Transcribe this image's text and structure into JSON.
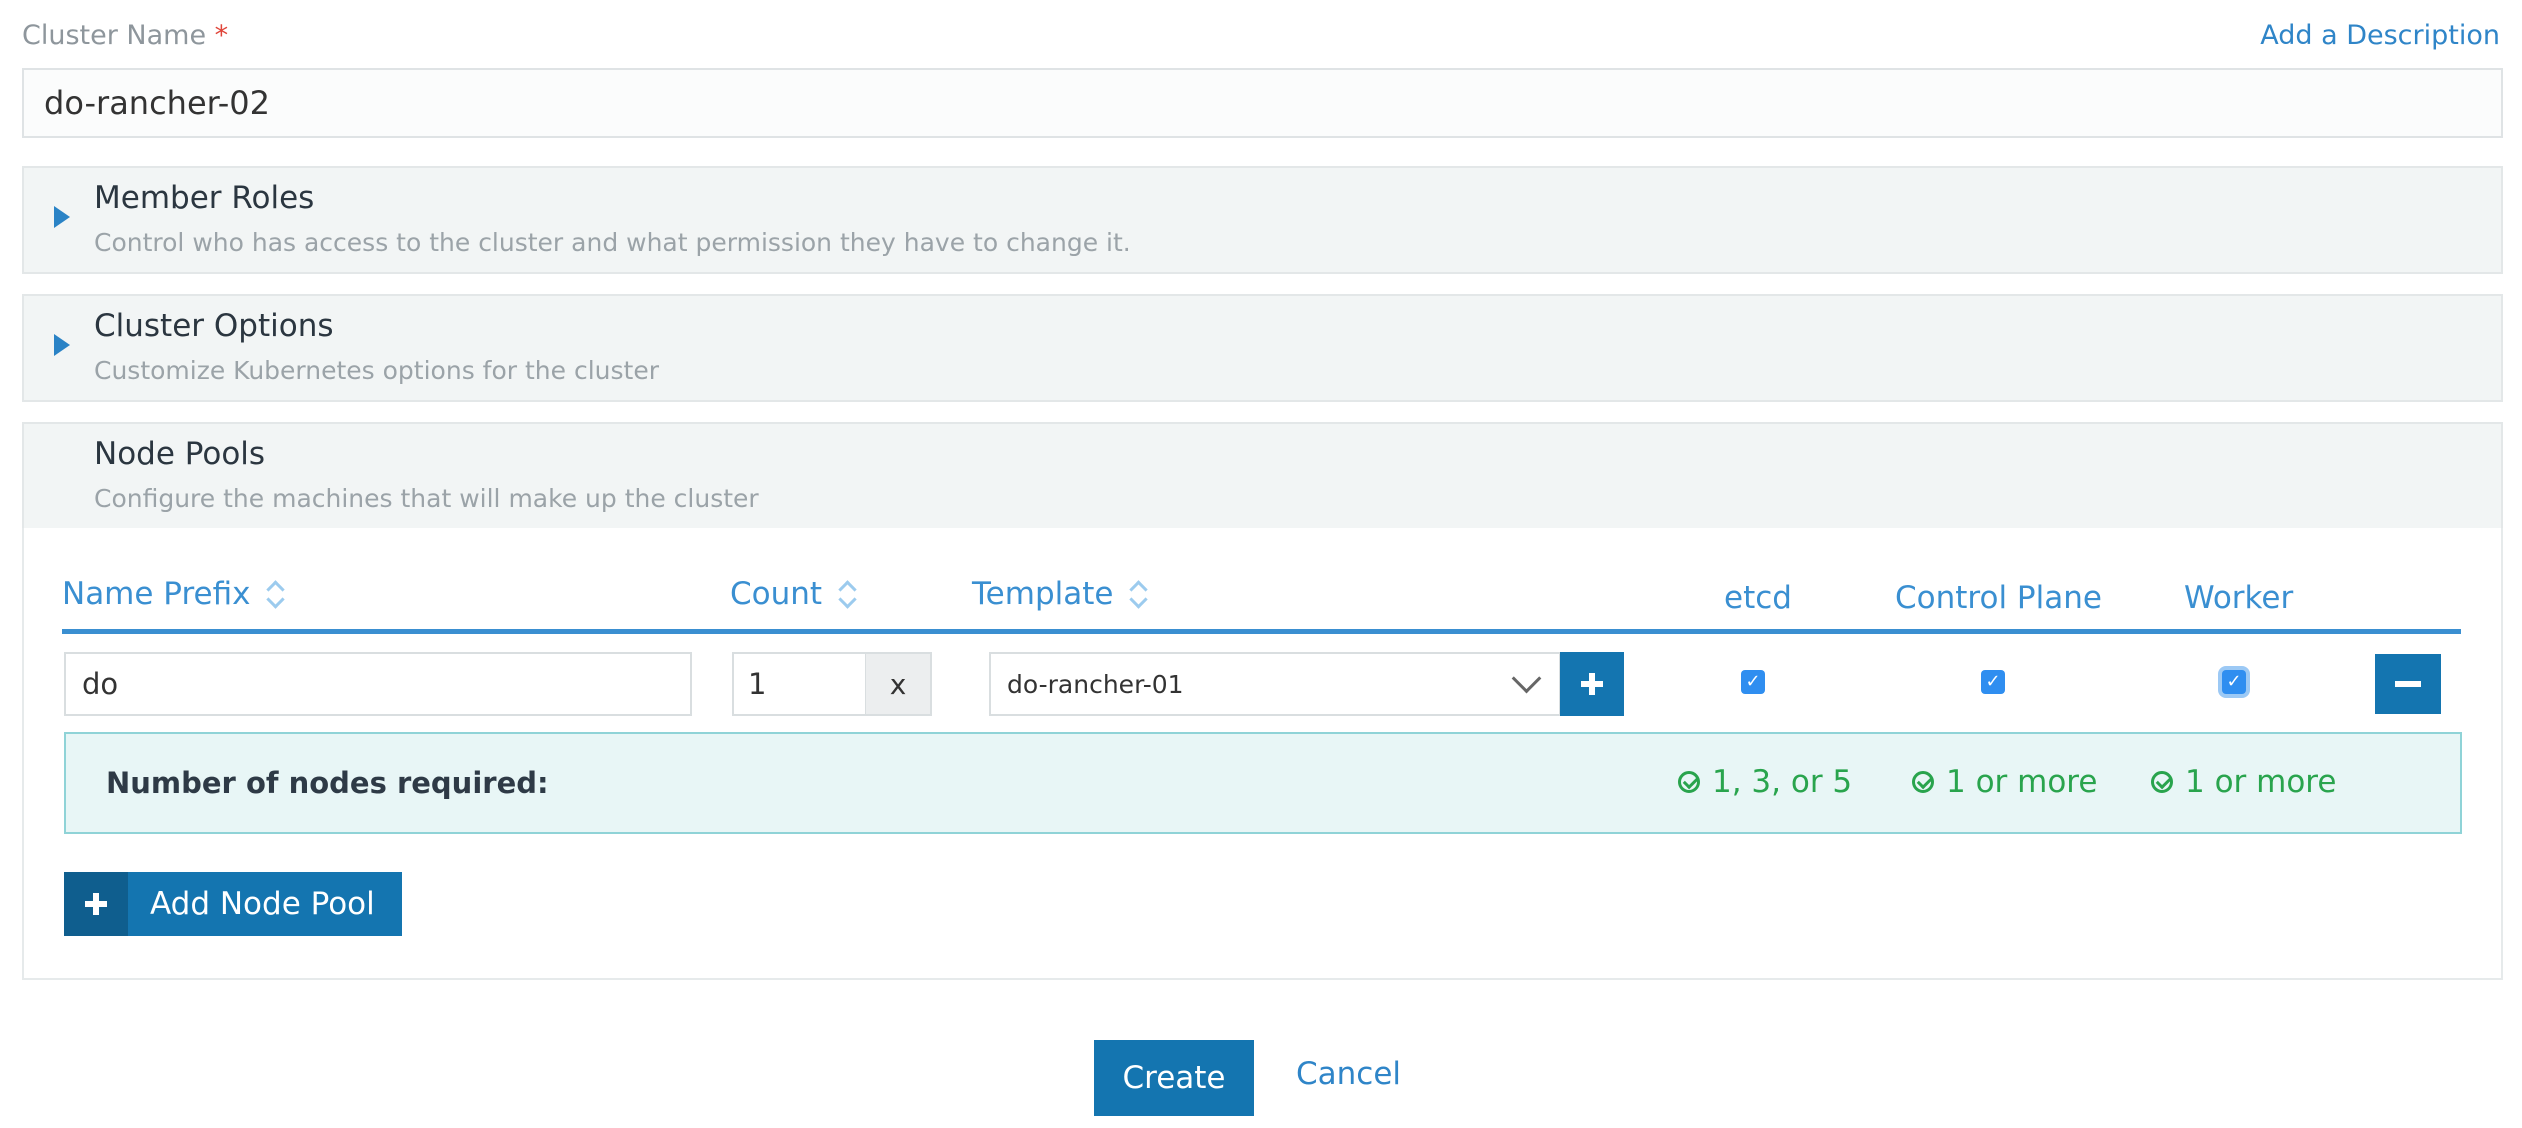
{
  "cluster": {
    "label": "Cluster Name",
    "required_mark": "*",
    "value": "do-rancher-02",
    "add_description": "Add a Description"
  },
  "sections": {
    "member_roles": {
      "title": "Member Roles",
      "desc": "Control who has access to the cluster and what permission they have to change it."
    },
    "cluster_options": {
      "title": "Cluster Options",
      "desc": "Customize Kubernetes options for the cluster"
    },
    "node_pools": {
      "title": "Node Pools",
      "desc": "Configure the machines that will make up the cluster"
    }
  },
  "table": {
    "headers": {
      "name_prefix": "Name Prefix",
      "count": "Count",
      "template": "Template",
      "etcd": "etcd",
      "control_plane": "Control Plane",
      "worker": "Worker"
    },
    "row": {
      "prefix": "do",
      "count": "1",
      "count_suffix": "x",
      "template": "do-rancher-01",
      "etcd": true,
      "control_plane": true,
      "worker": true
    }
  },
  "requirements": {
    "label": "Number of nodes required:",
    "etcd": "1, 3, or 5",
    "control_plane": "1 or more",
    "worker": "1 or more"
  },
  "buttons": {
    "add_node_pool": "Add Node Pool",
    "create": "Create",
    "cancel": "Cancel"
  },
  "colors": {
    "primary": "#1475b0",
    "link": "#2f85c8",
    "success": "#29a44d"
  }
}
